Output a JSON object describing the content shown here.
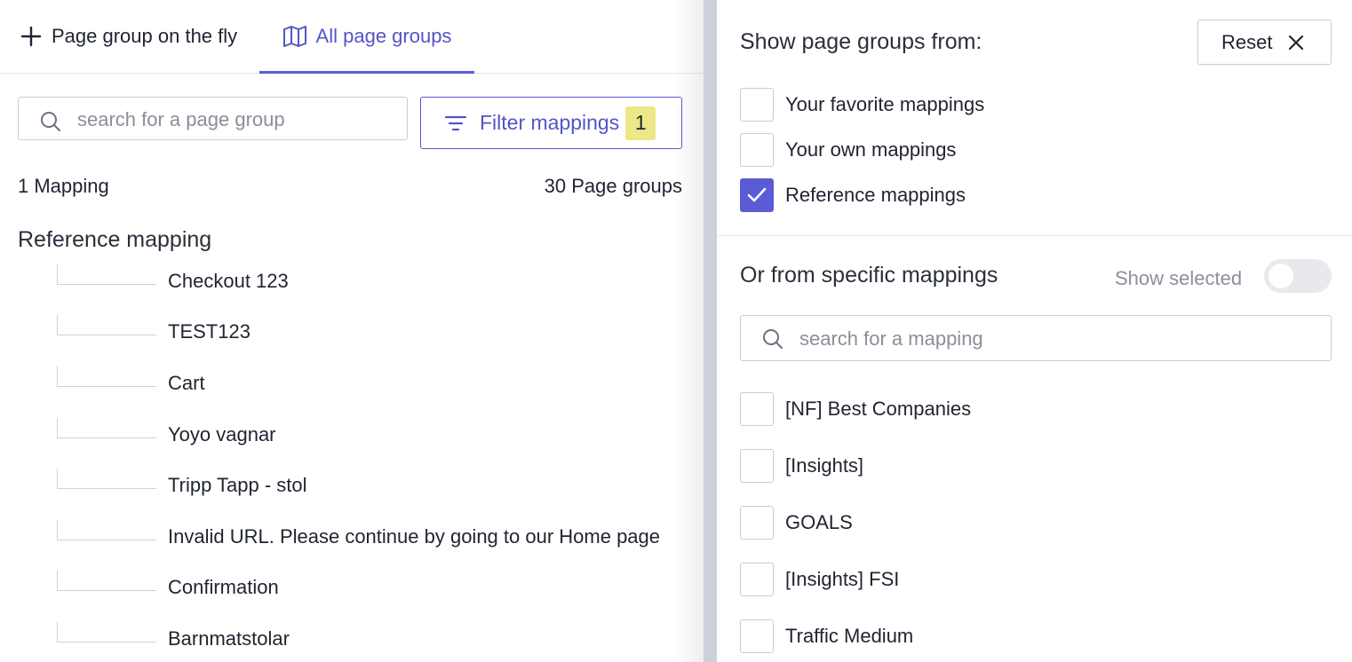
{
  "tabs": {
    "fly_label": "Page group on the fly",
    "all_label": "All page groups"
  },
  "left": {
    "search_placeholder": "search for a page group",
    "filter_label": "Filter mappings",
    "filter_count": "1",
    "mapping_count": "1 Mapping",
    "page_group_count": "30 Page groups",
    "section_title": "Reference mapping",
    "items": [
      "Checkout 123",
      "TEST123",
      "Cart",
      "Yoyo vagnar",
      "Tripp Tapp - stol",
      "Invalid URL. Please continue by going to our Home page",
      "Confirmation",
      "Barnmatstolar"
    ]
  },
  "right": {
    "title": "Show page groups from:",
    "reset_label": "Reset",
    "sources": [
      {
        "label": "Your favorite mappings",
        "checked": false
      },
      {
        "label": "Your own mappings",
        "checked": false
      },
      {
        "label": "Reference mappings",
        "checked": true
      }
    ],
    "specific_title": "Or from specific mappings",
    "show_selected_label": "Show selected",
    "show_selected_on": false,
    "search_placeholder": "search for a mapping",
    "mappings": [
      {
        "label": "[NF] Best Companies",
        "checked": false
      },
      {
        "label": "[Insights]",
        "checked": false
      },
      {
        "label": "GOALS",
        "checked": false
      },
      {
        "label": "[Insights] FSI",
        "checked": false
      },
      {
        "label": "Traffic Medium",
        "checked": false
      }
    ]
  },
  "colors": {
    "accent": "#5b5bd6",
    "badge": "#ece787",
    "border": "#c9ccd4"
  },
  "icons": {
    "tab_fly": "plus-icon",
    "tab_all": "map-icon",
    "search": "search-icon",
    "filter": "filter-icon",
    "reset": "close-icon",
    "checked": "check-icon"
  }
}
